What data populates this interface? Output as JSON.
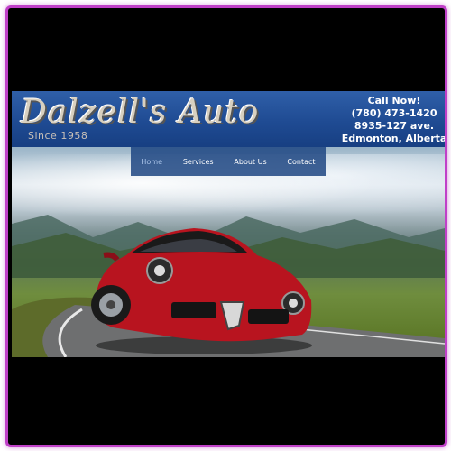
{
  "brand": {
    "name": "Dalzell's Auto",
    "since": "Since 1958"
  },
  "contact": {
    "call": "Call Now!",
    "phone": "(780) 473-1420",
    "address": "8935-127 ave.",
    "city": "Edmonton, Alberta"
  },
  "nav": {
    "items": [
      {
        "label": "Home"
      },
      {
        "label": "Services"
      },
      {
        "label": "About Us"
      },
      {
        "label": "Contact"
      }
    ]
  },
  "colors": {
    "frame": "#c040c8",
    "header": "#1f4b93",
    "car": "#c0182a"
  }
}
